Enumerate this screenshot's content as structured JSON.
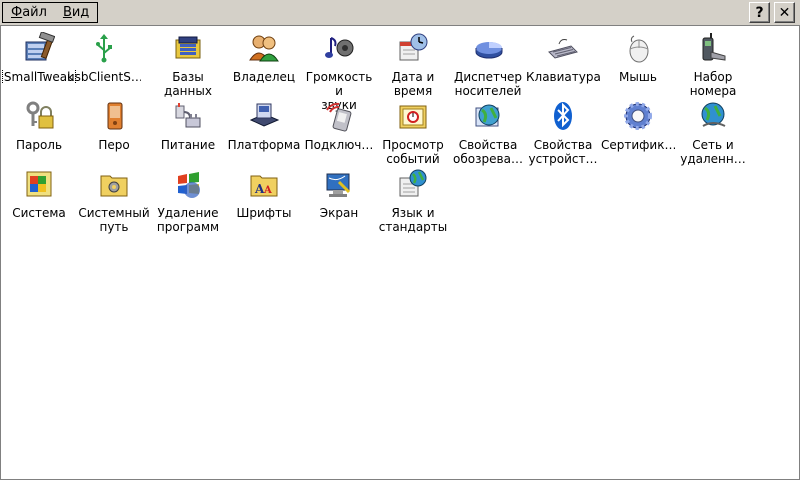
{
  "menu": {
    "file": "Файл",
    "file_ul": "Ф",
    "file_rest": "айл",
    "view": "Вид",
    "view_ul": "В",
    "view_rest": "ид"
  },
  "window_buttons": {
    "help": "?",
    "close": "✕"
  },
  "items": [
    {
      "label": "SmallTweak",
      "icon": "tools-icon"
    },
    {
      "label": "usbClientS…",
      "icon": "usb-icon"
    },
    {
      "label": "Базы данных",
      "icon": "database-icon"
    },
    {
      "label": "Владелец",
      "icon": "owner-icon"
    },
    {
      "label": "Громкость и\nзвуки",
      "icon": "speaker-icon"
    },
    {
      "label": "Дата и\nвремя",
      "icon": "clock-calendar-icon"
    },
    {
      "label": "Диспетчер\nносителей",
      "icon": "storage-pie-icon"
    },
    {
      "label": "Клавиатура",
      "icon": "keyboard-icon"
    },
    {
      "label": "Мышь",
      "icon": "mouse-icon"
    },
    {
      "label": "Набор\nномера",
      "icon": "phone-dial-icon"
    },
    {
      "label": "Пароль",
      "icon": "key-lock-icon"
    },
    {
      "label": "Перо",
      "icon": "stylus-device-icon"
    },
    {
      "label": "Питание",
      "icon": "power-plug-icon"
    },
    {
      "label": "Платформа",
      "icon": "platform-icon"
    },
    {
      "label": "Подключ…",
      "icon": "connection-icon"
    },
    {
      "label": "Просмотр\nсобытий",
      "icon": "event-viewer-icon"
    },
    {
      "label": "Свойства\nобозрева…",
      "icon": "browser-globe-icon"
    },
    {
      "label": "Свойства\nустройст…",
      "icon": "bluetooth-icon"
    },
    {
      "label": "Сертифик…",
      "icon": "certificate-gear-icon"
    },
    {
      "label": "Сеть и\nудаленн…",
      "icon": "network-globe-icon"
    },
    {
      "label": "Система",
      "icon": "system-icon"
    },
    {
      "label": "Системный\nпуть",
      "icon": "folder-gear-icon"
    },
    {
      "label": "Удаление\nпрограмм",
      "icon": "uninstall-windows-icon"
    },
    {
      "label": "Шрифты",
      "icon": "fonts-folder-icon"
    },
    {
      "label": "Экран",
      "icon": "display-icon"
    },
    {
      "label": "Язык и\nстандарты",
      "icon": "language-globe-icon"
    }
  ]
}
